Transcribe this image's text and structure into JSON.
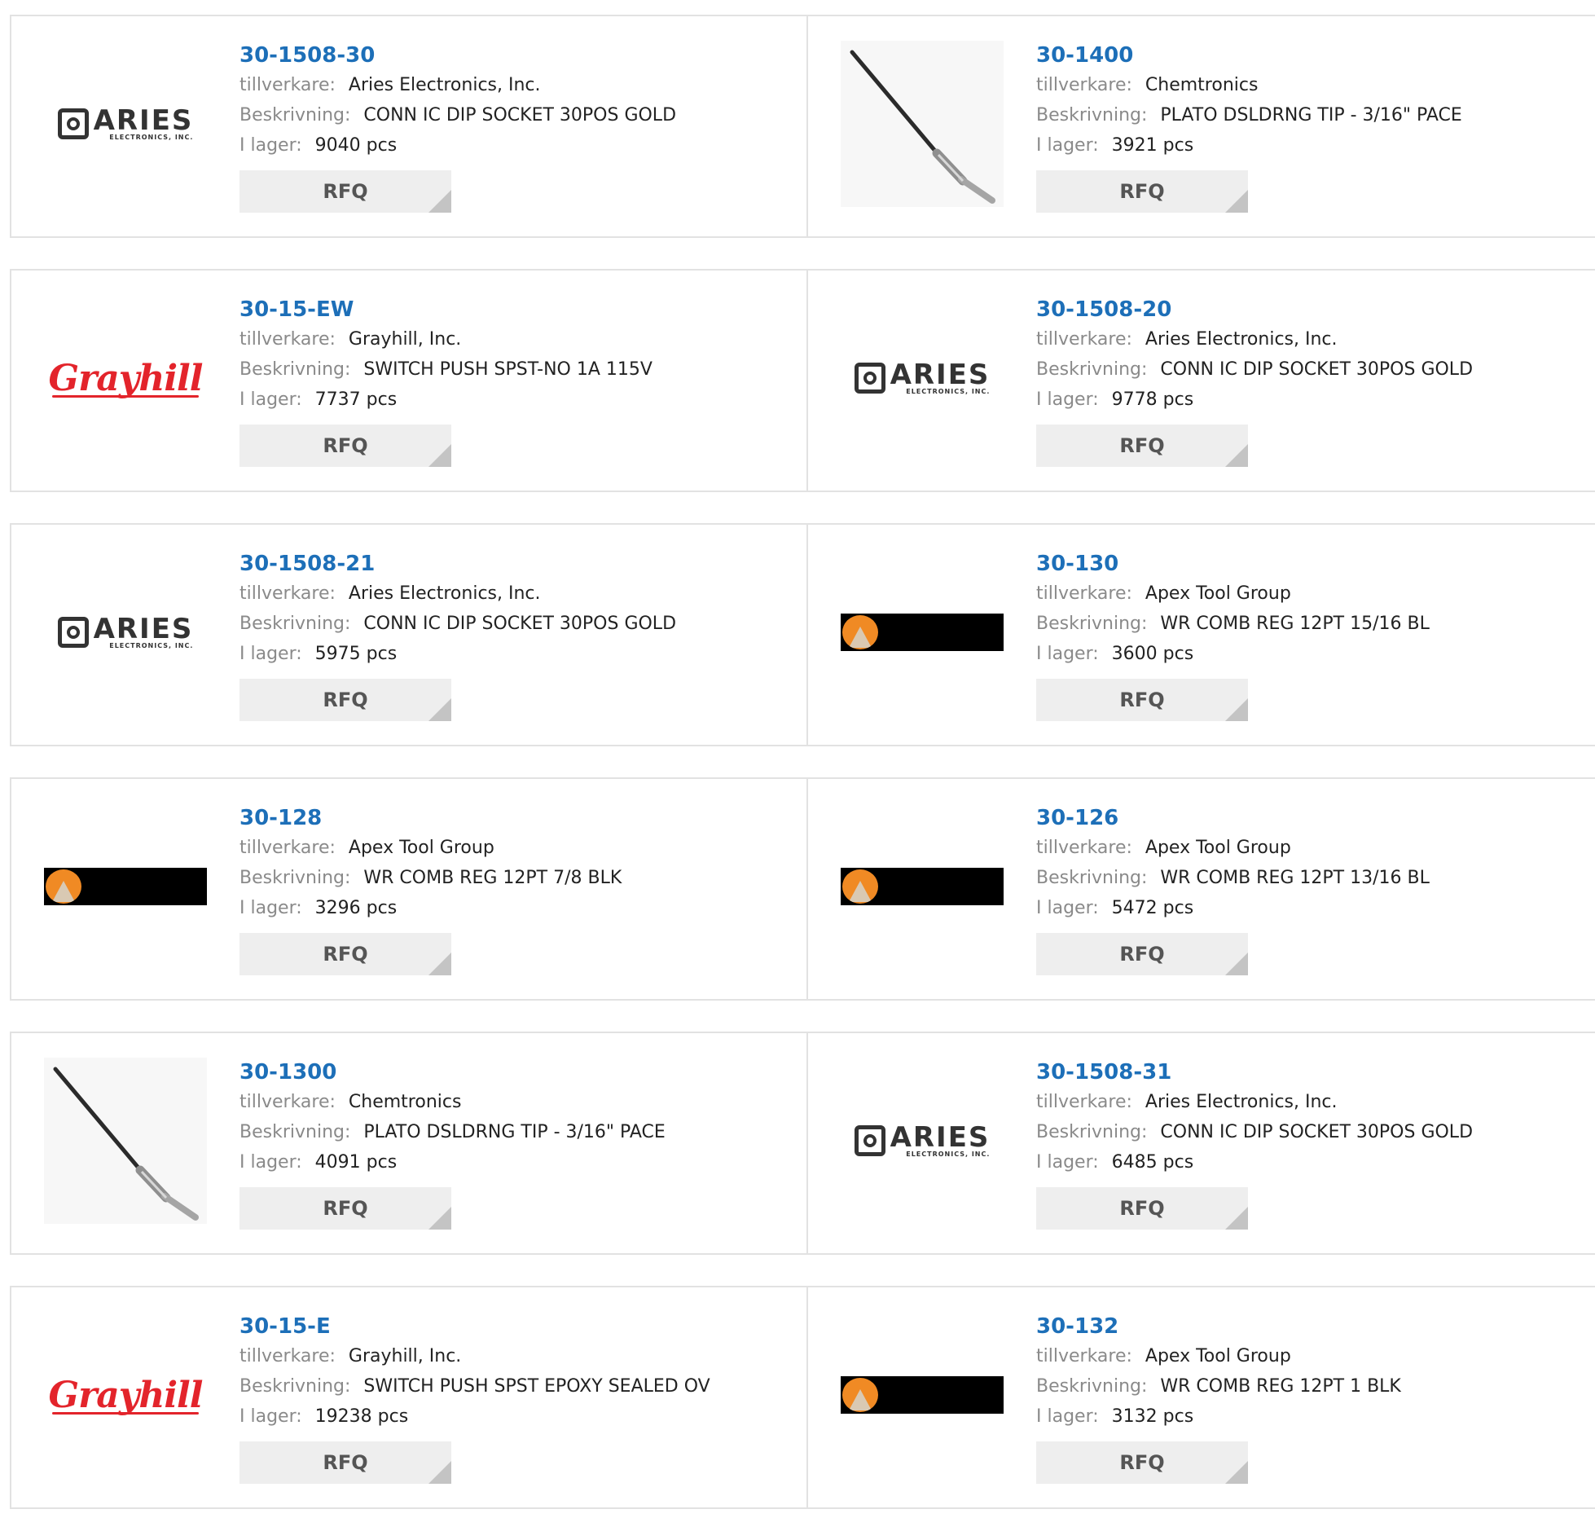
{
  "labels": {
    "manufacturer": "tillverkare:",
    "description": "Beskrivning:",
    "stock": "I lager:",
    "rfq": "RFQ"
  },
  "products": [
    {
      "part": "30-1508-30",
      "manufacturer": "Aries Electronics, Inc.",
      "description": "CONN IC DIP SOCKET 30POS GOLD",
      "stock": "9040 pcs",
      "logo": "aries-logo"
    },
    {
      "part": "30-1400",
      "manufacturer": "Chemtronics",
      "description": "PLATO DSLDRNG TIP - 3/16\" PACE",
      "stock": "3921 pcs",
      "logo": "solder-tip-image"
    },
    {
      "part": "30-15-EW",
      "manufacturer": "Grayhill, Inc.",
      "description": "SWITCH PUSH SPST-NO 1A 115V",
      "stock": "7737 pcs",
      "logo": "grayhill-logo"
    },
    {
      "part": "30-1508-20",
      "manufacturer": "Aries Electronics, Inc.",
      "description": "CONN IC DIP SOCKET 30POS GOLD",
      "stock": "9778 pcs",
      "logo": "aries-logo"
    },
    {
      "part": "30-1508-21",
      "manufacturer": "Aries Electronics, Inc.",
      "description": "CONN IC DIP SOCKET 30POS GOLD",
      "stock": "5975 pcs",
      "logo": "aries-logo"
    },
    {
      "part": "30-130",
      "manufacturer": "Apex Tool Group",
      "description": "WR COMB REG 12PT 15/16 BL",
      "stock": "3600 pcs",
      "logo": "apex-logo"
    },
    {
      "part": "30-128",
      "manufacturer": "Apex Tool Group",
      "description": "WR COMB REG 12PT 7/8 BLK",
      "stock": "3296 pcs",
      "logo": "apex-logo"
    },
    {
      "part": "30-126",
      "manufacturer": "Apex Tool Group",
      "description": "WR COMB REG 12PT 13/16 BL",
      "stock": "5472 pcs",
      "logo": "apex-logo"
    },
    {
      "part": "30-1300",
      "manufacturer": "Chemtronics",
      "description": "PLATO DSLDRNG TIP - 3/16\" PACE",
      "stock": "4091 pcs",
      "logo": "solder-tip-image"
    },
    {
      "part": "30-1508-31",
      "manufacturer": "Aries Electronics, Inc.",
      "description": "CONN IC DIP SOCKET 30POS GOLD",
      "stock": "6485 pcs",
      "logo": "aries-logo"
    },
    {
      "part": "30-15-E",
      "manufacturer": "Grayhill, Inc.",
      "description": "SWITCH PUSH SPST EPOXY SEALED OV",
      "stock": "19238 pcs",
      "logo": "grayhill-logo"
    },
    {
      "part": "30-132",
      "manufacturer": "Apex Tool Group",
      "description": "WR COMB REG 12PT 1 BLK",
      "stock": "3132 pcs",
      "logo": "apex-logo"
    }
  ],
  "logo_text": {
    "aries_word": "ARIES",
    "aries_sub": "ELECTRONICS, INC.",
    "grayhill_word": "Grayhill"
  },
  "colors": {
    "part_link": "#1d6fb8",
    "label_gray": "#8a8a8a",
    "rfq_bg": "#eeeeee",
    "grayhill_red": "#e3242b",
    "apex_orange": "#f08a24"
  }
}
